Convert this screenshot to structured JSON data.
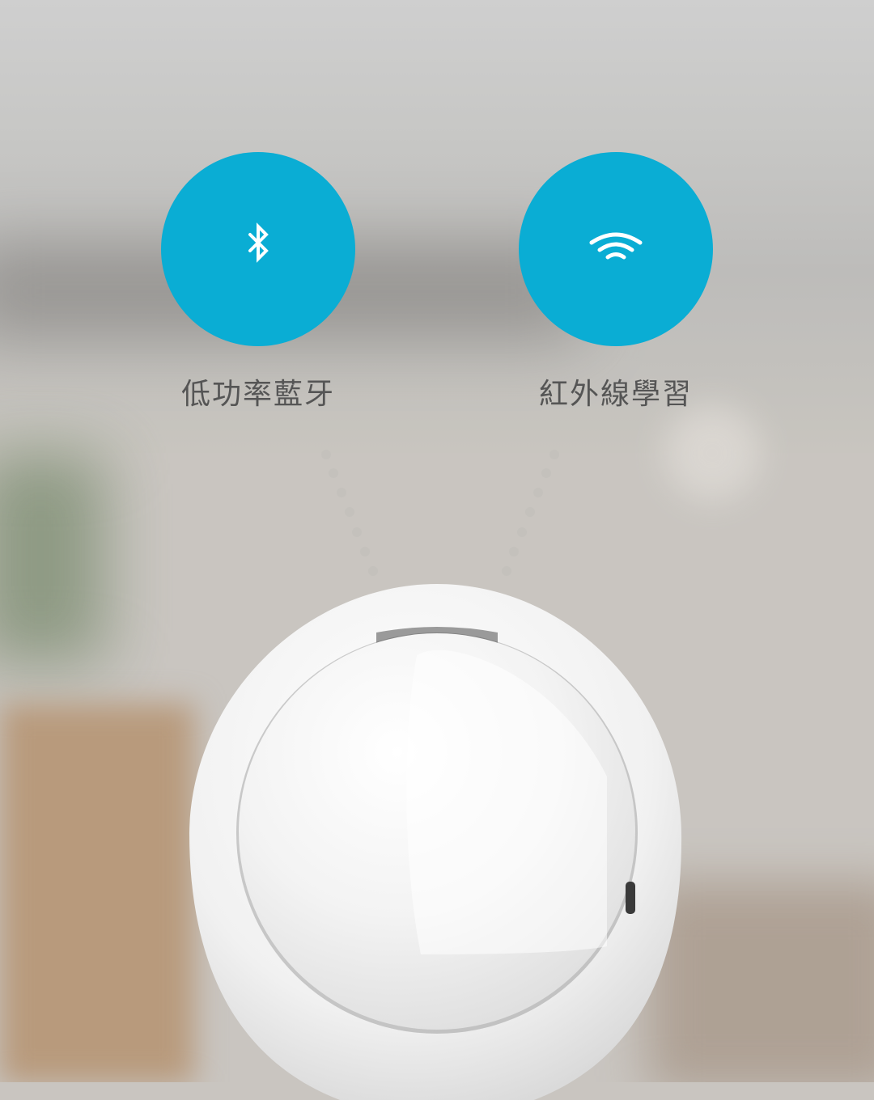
{
  "features": [
    {
      "label": "低功率藍牙",
      "icon": "bluetooth-icon"
    },
    {
      "label": "紅外線學習",
      "icon": "wifi-icon"
    }
  ],
  "colors": {
    "accent": "#0aadd4",
    "label_text": "#555555",
    "dots": "#c4c1bc"
  }
}
